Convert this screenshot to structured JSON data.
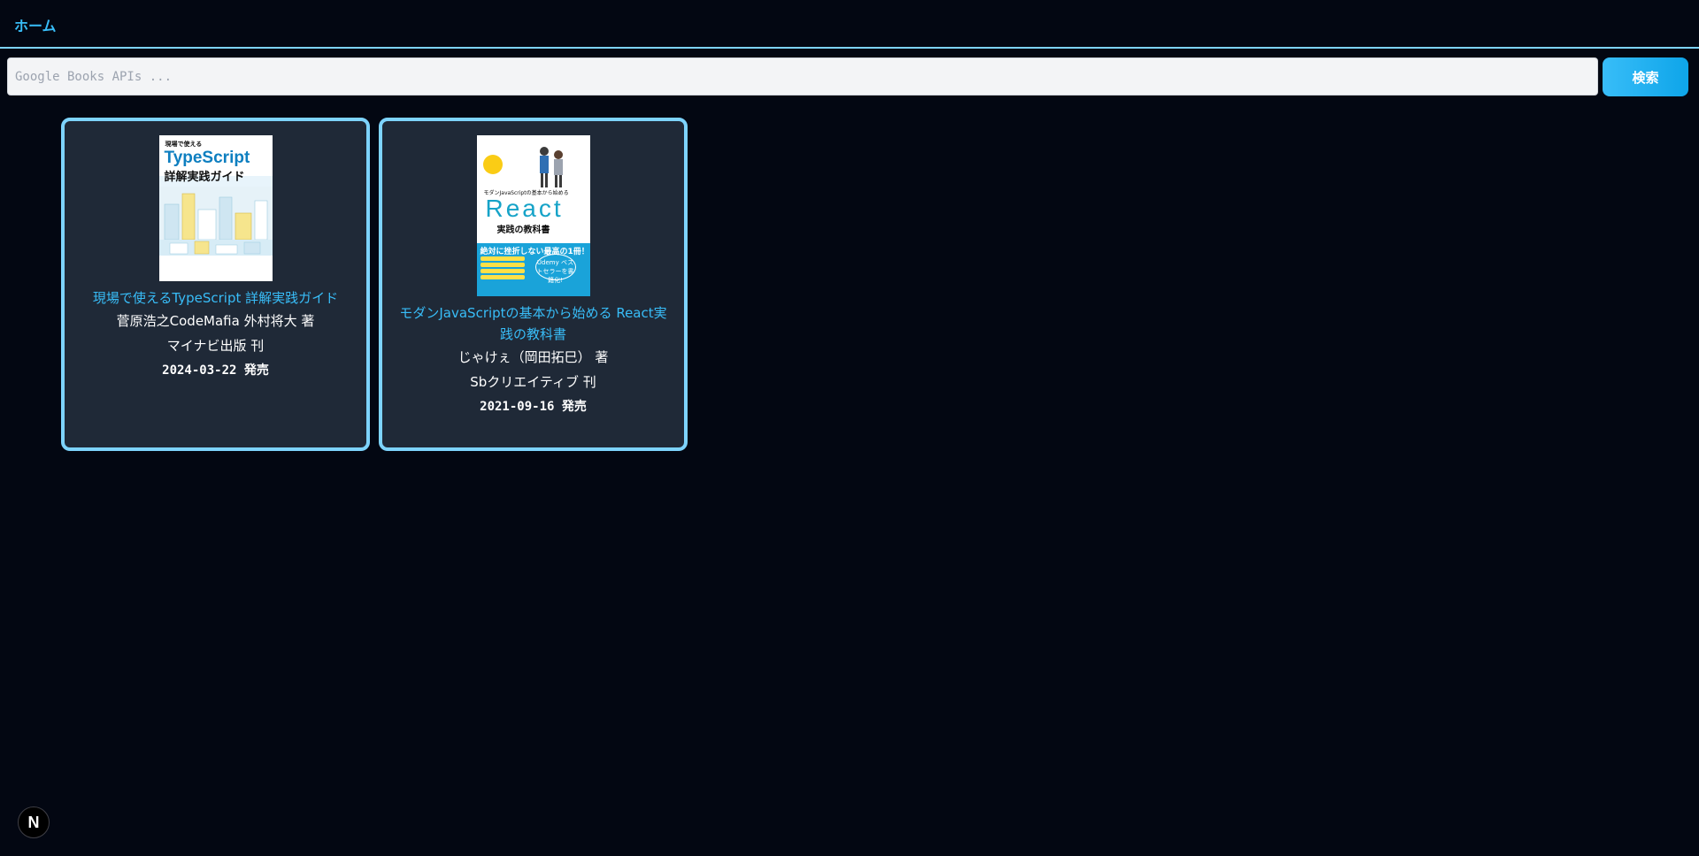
{
  "header": {
    "home_label": "ホーム"
  },
  "search": {
    "placeholder": "Google Books APIs ...",
    "value": "",
    "button_label": "検索"
  },
  "books": [
    {
      "title": "現場で使えるTypeScript 詳解実践ガイド",
      "authors": "菅原浩之CodeMafia 外村将大 著",
      "publisher": "マイナビ出版 刊",
      "published": "2024-03-22 発売",
      "cover": {
        "small_text": "現場で使える",
        "main_text": "TypeScript",
        "sub_text": "詳解実践ガイド"
      }
    },
    {
      "title": "モダンJavaScriptの基本から始める React実践の教科書",
      "authors": "じゃけぇ（岡田拓巳） 著",
      "publisher": "Sbクリエイティブ 刊",
      "published": "2021-09-16 発売",
      "cover": {
        "top_text": "モダンJavaScriptの基本から始める",
        "main_text": "React",
        "sub_text": "実践の教科書",
        "band_text": "絶対に挫折しない最高の1冊！",
        "circle_text": "Udemy ベストセラーを書籍化!"
      }
    }
  ],
  "footer": {
    "badge_label": "N"
  },
  "colors": {
    "background": "#030712",
    "accent": "#38bdf8",
    "card_border": "#7dd3fc",
    "card_bg": "#1f2937"
  }
}
